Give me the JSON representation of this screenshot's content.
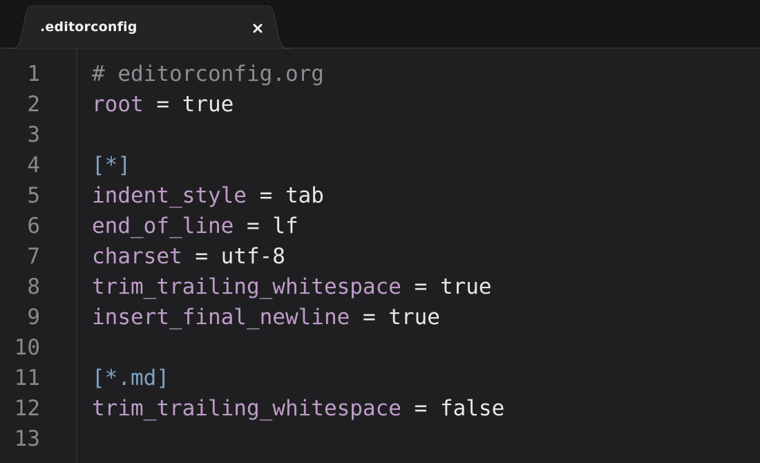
{
  "tab": {
    "title": ".editorconfig",
    "close_icon": "close-icon"
  },
  "colors": {
    "background": "#1f1f21",
    "tabbar": "#161617",
    "tab": "#242426",
    "line_number": "#8a8a8e",
    "comment": "#8e8e92",
    "key": "#bf9cc9",
    "section": "#7fa3c4",
    "text": "#e6e6e6"
  },
  "lines": [
    {
      "number": "1",
      "tokens": [
        {
          "type": "comment",
          "text": "# editorconfig.org"
        }
      ]
    },
    {
      "number": "2",
      "tokens": [
        {
          "type": "key",
          "text": "root"
        },
        {
          "type": "op",
          "text": " = "
        },
        {
          "type": "value",
          "text": "true"
        }
      ]
    },
    {
      "number": "3",
      "tokens": []
    },
    {
      "number": "4",
      "tokens": [
        {
          "type": "section",
          "text": "[*]"
        }
      ]
    },
    {
      "number": "5",
      "tokens": [
        {
          "type": "key",
          "text": "indent_style"
        },
        {
          "type": "op",
          "text": " = "
        },
        {
          "type": "value",
          "text": "tab"
        }
      ]
    },
    {
      "number": "6",
      "tokens": [
        {
          "type": "key",
          "text": "end_of_line"
        },
        {
          "type": "op",
          "text": " = "
        },
        {
          "type": "value",
          "text": "lf"
        }
      ]
    },
    {
      "number": "7",
      "tokens": [
        {
          "type": "key",
          "text": "charset"
        },
        {
          "type": "op",
          "text": " = "
        },
        {
          "type": "value",
          "text": "utf-8"
        }
      ]
    },
    {
      "number": "8",
      "tokens": [
        {
          "type": "key",
          "text": "trim_trailing_whitespace"
        },
        {
          "type": "op",
          "text": " = "
        },
        {
          "type": "value",
          "text": "true"
        }
      ]
    },
    {
      "number": "9",
      "tokens": [
        {
          "type": "key",
          "text": "insert_final_newline"
        },
        {
          "type": "op",
          "text": " = "
        },
        {
          "type": "value",
          "text": "true"
        }
      ]
    },
    {
      "number": "10",
      "tokens": []
    },
    {
      "number": "11",
      "tokens": [
        {
          "type": "section",
          "text": "[*.md]"
        }
      ]
    },
    {
      "number": "12",
      "tokens": [
        {
          "type": "key",
          "text": "trim_trailing_whitespace"
        },
        {
          "type": "op",
          "text": " = "
        },
        {
          "type": "value",
          "text": "false"
        }
      ]
    },
    {
      "number": "13",
      "tokens": []
    }
  ]
}
